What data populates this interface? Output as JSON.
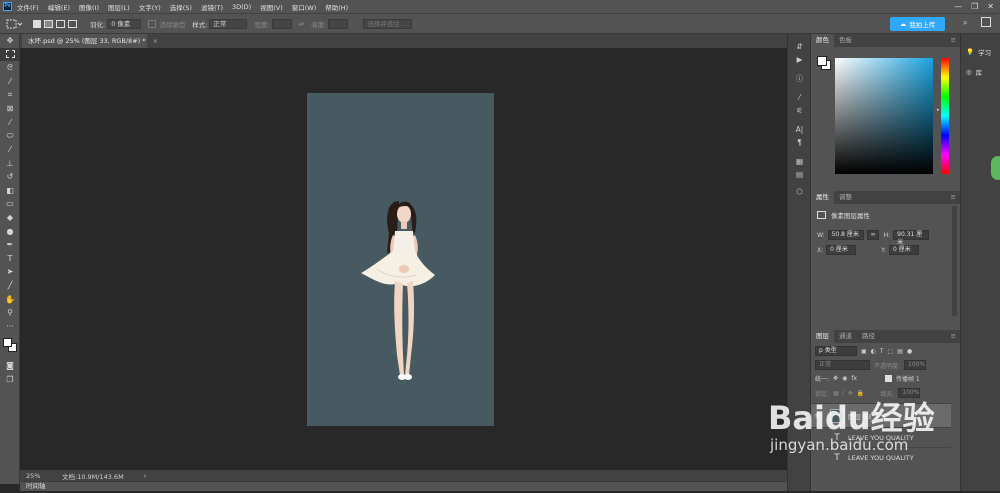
{
  "app": {
    "logo": "Ps"
  },
  "menu": [
    "文件(F)",
    "编辑(E)",
    "图像(I)",
    "图层(L)",
    "文字(Y)",
    "选择(S)",
    "滤镜(T)",
    "3D(D)",
    "视图(V)",
    "窗口(W)",
    "帮助(H)"
  ],
  "window_controls": [
    "—",
    "❐",
    "✕"
  ],
  "options": {
    "feather_label": "羽化:",
    "feather_value": "0 像素",
    "antialias": "消除锯齿",
    "style_label": "样式:",
    "style_value": "正常",
    "width_label": "宽度:",
    "height_label": "高度:",
    "select_mask": "选择并遮住 ...",
    "cloud_button": "我拍上传"
  },
  "document": {
    "tab_title": "水坏.psd @ 25% (图层 33, RGB/8#) *",
    "canvas_color": "#485a61"
  },
  "status": {
    "zoom": "25%",
    "doc_info": "文档:10.9M/143.6M",
    "arrow": "›"
  },
  "timeline_label": "时间轴",
  "color_panel": {
    "tabs": [
      "颜色",
      "色板"
    ],
    "menu": "≡"
  },
  "properties_panel": {
    "tabs": [
      "属性",
      "调整"
    ],
    "subtitle": "像素图层属性",
    "w_label": "W:",
    "w_value": "50.8 厘米",
    "h_label": "H:",
    "h_value": "90.31 厘米",
    "x_label": "X:",
    "x_value": "0 厘米",
    "y_label": "Y:",
    "y_value": "0 厘米",
    "link": "∞"
  },
  "layers_panel": {
    "tabs": [
      "图层",
      "通道",
      "路径"
    ],
    "filter_kind": "p 类型",
    "blend_mode": "正常",
    "opacity_label": "不透明度:",
    "opacity_value": "100%",
    "unify_label": "统一:",
    "propagate_label": "传播帧 1",
    "lock_label": "锁定:",
    "fill_label": "填充:",
    "fill_value": "100%",
    "layers": [
      {
        "name": "图层 33",
        "type": "pixel"
      },
      {
        "name": "LEAVE YOU QUALITY",
        "type": "text"
      },
      {
        "name": "LEAVE YOU QUALITY",
        "type": "text"
      }
    ]
  },
  "right_strip": [
    {
      "icon": "lightbulb-icon",
      "label": "学习"
    },
    {
      "icon": "library-icon",
      "label": "库"
    }
  ],
  "watermark": {
    "text": "Baidu经验",
    "url": "jingyan.baidu.com"
  },
  "colors": {
    "accent": "#31a8ff",
    "fg": "#ffffff",
    "bg": "#ffffff"
  }
}
